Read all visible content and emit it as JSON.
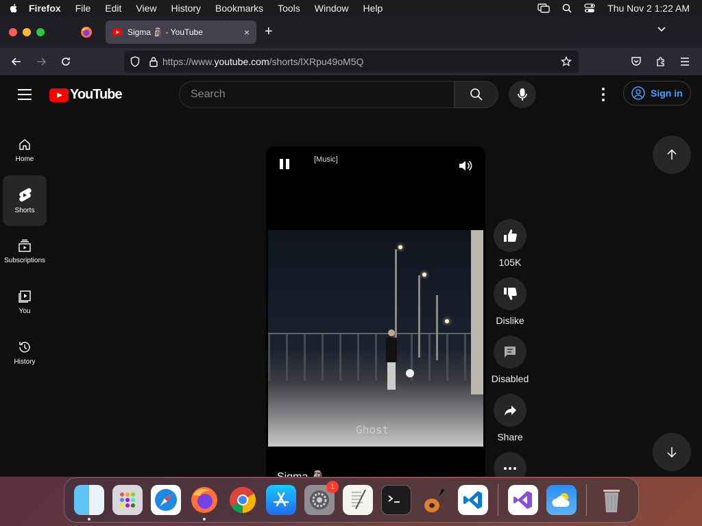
{
  "menubar": {
    "app": "Firefox",
    "items": [
      "File",
      "Edit",
      "View",
      "History",
      "Bookmarks",
      "Tools",
      "Window",
      "Help"
    ],
    "clock": "Thu Nov 2  1:22 AM"
  },
  "browser": {
    "tab_title": "Sigma 🗿 - YouTube",
    "tab_close": "×",
    "new_tab": "+",
    "url_prefix": "https://www.",
    "url_domain": "youtube.com",
    "url_path": "/shorts/lXRpu49oM5Q"
  },
  "youtube": {
    "logo_text": "YouTube",
    "search_placeholder": "Search",
    "signin_label": "Sign in",
    "guide": [
      {
        "label": "Home"
      },
      {
        "label": "Shorts"
      },
      {
        "label": "Subscriptions"
      },
      {
        "label": "You"
      },
      {
        "label": "History"
      }
    ],
    "player": {
      "caption": "[Music]",
      "watermark": "Ghost",
      "title": "Sigma 🗿"
    },
    "actions": {
      "like": "105K",
      "dislike": "Dislike",
      "comments": "Disabled",
      "share": "Share"
    }
  },
  "dock": {
    "apps": [
      "finder-icon",
      "launchpad-icon",
      "safari-icon",
      "firefox-icon",
      "chrome-icon",
      "app-store-icon",
      "system-settings-icon",
      "textedit-icon",
      "terminal-icon",
      "garageband-icon",
      "vscode-icon",
      "visual-studio-icon",
      "weather-icon",
      "trash-icon"
    ],
    "settings_badge": "1"
  },
  "colors": {
    "youtube_red": "#ff0000",
    "signin_blue": "#3ea6ff",
    "dark_bg": "#0f0f0f"
  }
}
